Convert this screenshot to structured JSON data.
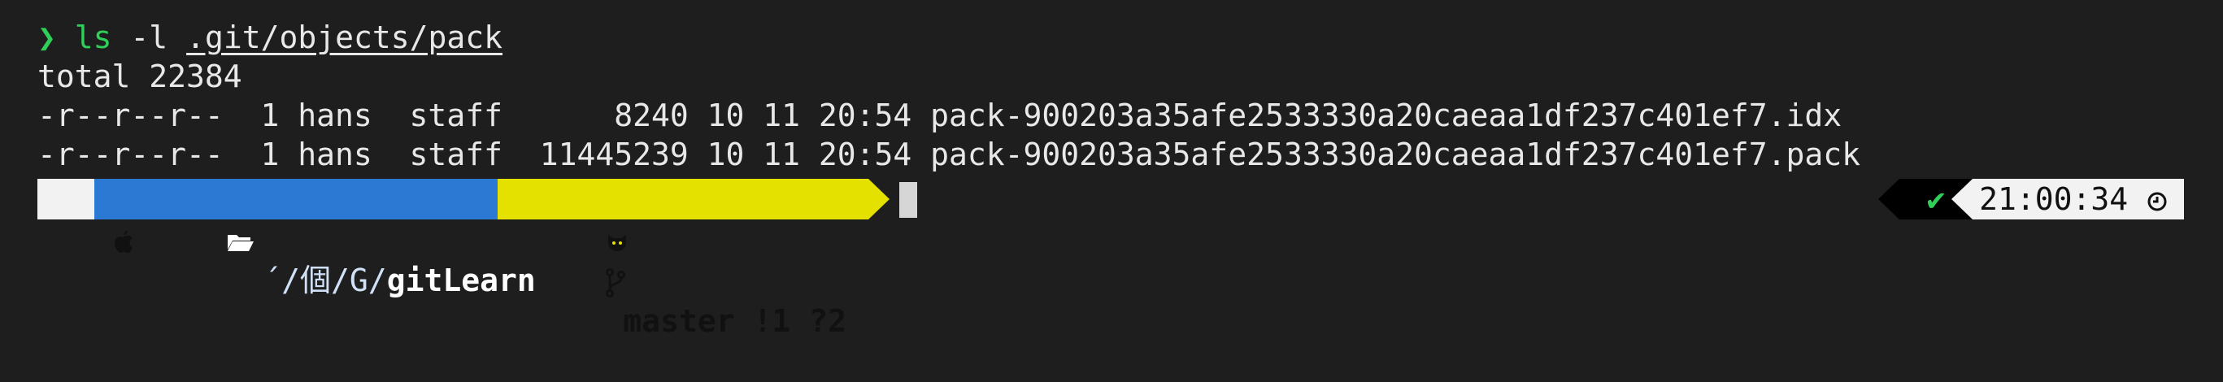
{
  "prompt": {
    "symbol": "❯",
    "command": "ls",
    "args": " -l ",
    "path": ".git/objects/pack"
  },
  "output": [
    "total 22384",
    "-r--r--r--  1 hans  staff      8240 10 11 20:54 pack-900203a35afe2533330a20caeaa1df237c401ef7.idx",
    "-r--r--r--  1 hans  staff  11445239 10 11 20:54 pack-900203a35afe2533330a20caeaa1df237c401ef7.pack"
  ],
  "status": {
    "apple_icon": "apple-icon",
    "folder_icon": "folder-open-icon",
    "dir_prefix": "´/個",
    "dir_mid": "/G/",
    "dir_name": "gitLearn",
    "git_icon": "github-cat-icon",
    "branch_icon": "git-branch-icon",
    "branch": "master !1 ?2"
  },
  "right_prompt": {
    "status_symbol": "✔",
    "time": "21:00:34",
    "clock_icon": "clock-icon"
  },
  "colors": {
    "background": "#1e1e1e",
    "prompt_green": "#2fcf5a",
    "dir_blue": "#2b79d3",
    "git_yellow": "#e4e000"
  }
}
